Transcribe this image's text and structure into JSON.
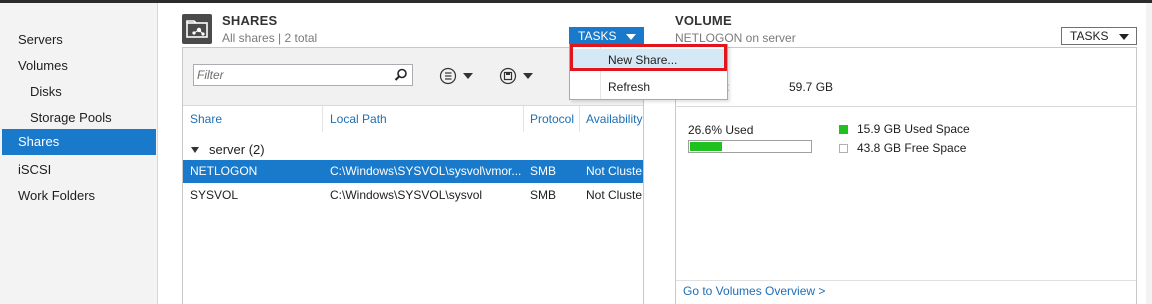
{
  "sidebar": {
    "items": [
      {
        "label": "Servers"
      },
      {
        "label": "Volumes"
      },
      {
        "label": "Disks"
      },
      {
        "label": "Storage Pools"
      },
      {
        "label": "Shares"
      },
      {
        "label": "iSCSI"
      },
      {
        "label": "Work Folders"
      }
    ]
  },
  "shares": {
    "title": "SHARES",
    "subtitle": "All shares | 2 total",
    "tasks_label": "TASKS",
    "filter_placeholder": "Filter",
    "columns": [
      "Share",
      "Local Path",
      "Protocol",
      "Availability"
    ],
    "group_label": "server (2)",
    "rows": [
      {
        "share": "NETLOGON",
        "path": "C:\\Windows\\SYSVOL\\sysvol\\vmor...",
        "protocol": "SMB",
        "availability": "Not Cluste"
      },
      {
        "share": "SYSVOL",
        "path": "C:\\Windows\\SYSVOL\\sysvol",
        "protocol": "SMB",
        "availability": "Not Cluste"
      }
    ]
  },
  "tasks_menu": {
    "items": [
      "New Share...",
      "Refresh"
    ]
  },
  "volume": {
    "title": "VOLUME",
    "subtitle": "NETLOGON on server",
    "tasks_label": "TASKS",
    "capacity_label": "y:",
    "capacity_value": "59.7 GB",
    "used_pct_label": "26.6% Used",
    "used_fraction": 0.266,
    "used_legend": "15.9 GB Used Space",
    "free_legend": "43.8 GB Free Space",
    "overview_link": "Go to Volumes Overview >"
  },
  "colors": {
    "accent": "#1979ca",
    "used": "#1fc11f",
    "free": "#ffffff",
    "highlight": "#e0161c"
  }
}
